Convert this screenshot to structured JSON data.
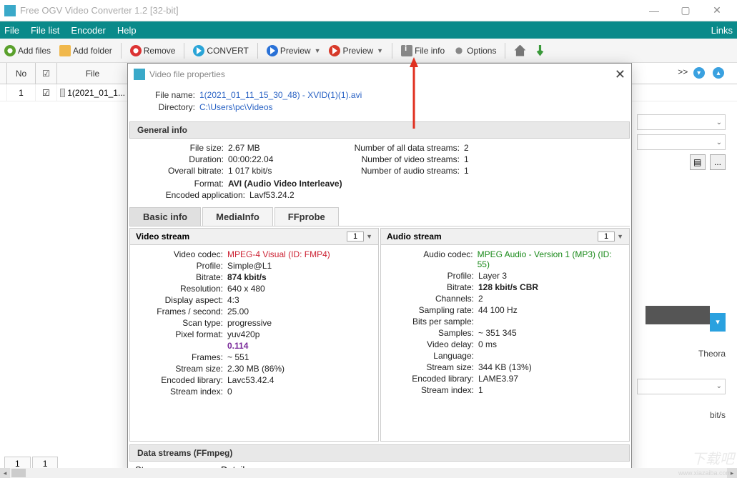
{
  "app": {
    "title": "Free OGV Video Converter 1.2  [32-bit]"
  },
  "menu": {
    "file": "File",
    "filelist": "File list",
    "encoder": "Encoder",
    "help": "Help",
    "links": "Links"
  },
  "tool": {
    "addfiles": "Add files",
    "addfolder": "Add folder",
    "remove": "Remove",
    "convert": "CONVERT",
    "preview1": "Preview",
    "preview2": "Preview",
    "fileinfo": "File info",
    "options": "Options"
  },
  "list": {
    "hdr_no": "No",
    "hdr_file": "File",
    "row1_no": "1",
    "row1_file": "1(2021_01_1..."
  },
  "pager": {
    "p1": "1",
    "p2": "1"
  },
  "right": {
    "theora": "Theora",
    "bits": "bit/s",
    "ellipsis": "...",
    "chevrons": ">>"
  },
  "dialog": {
    "title": "Video file properties",
    "filename_k": "File name:",
    "filename_v": "1(2021_01_11_15_30_48) - XVID(1)(1).avi",
    "directory_k": "Directory:",
    "directory_v": "C:\\Users\\pc\\Videos",
    "general_hdr": "General info",
    "g_filesize_k": "File size:",
    "g_filesize_v": "2.67 MB",
    "g_duration_k": "Duration:",
    "g_duration_v": "00:00:22.04",
    "g_bitrate_k": "Overall bitrate:",
    "g_bitrate_v": "1 017 kbit/s",
    "g_format_k": "Format:",
    "g_format_v": "AVI (Audio Video Interleave)",
    "g_encapp_k": "Encoded application:",
    "g_encapp_v": "Lavf53.24.2",
    "g_allstreams_k": "Number of all data streams:",
    "g_allstreams_v": "2",
    "g_vidstreams_k": "Number of video streams:",
    "g_vidstreams_v": "1",
    "g_audstreams_k": "Number of audio streams:",
    "g_audstreams_v": "1",
    "tabs": {
      "basic": "Basic info",
      "media": "MediaInfo",
      "ffprobe": "FFprobe"
    },
    "video": {
      "hdr": "Video stream",
      "num": "1",
      "codec_k": "Video codec:",
      "codec_v": "MPEG-4 Visual (ID: FMP4)",
      "profile_k": "Profile:",
      "profile_v": "Simple@L1",
      "bitrate_k": "Bitrate:",
      "bitrate_v": "874 kbit/s",
      "res_k": "Resolution:",
      "res_v": "640 x 480",
      "aspect_k": "Display aspect:",
      "aspect_v": "4:3",
      "fps_k": "Frames / second:",
      "fps_v": "25.00",
      "scan_k": "Scan type:",
      "scan_v": "progressive",
      "pix_k": "Pixel format:",
      "pix_v": "yuv420p",
      "val_k": "",
      "val_v": "0.114",
      "frames_k": "Frames:",
      "frames_v": "~ 551",
      "ssize_k": "Stream size:",
      "ssize_v": "2.30 MB (86%)",
      "enclib_k": "Encoded library:",
      "enclib_v": "Lavc53.42.4",
      "sidx_k": "Stream index:",
      "sidx_v": "0"
    },
    "audio": {
      "hdr": "Audio stream",
      "num": "1",
      "codec_k": "Audio codec:",
      "codec_v": "MPEG Audio - Version 1 (MP3) (ID: 55)",
      "profile_k": "Profile:",
      "profile_v": "Layer 3",
      "bitrate_k": "Bitrate:",
      "bitrate_v": "128 kbit/s  CBR",
      "ch_k": "Channels:",
      "ch_v": "2",
      "sr_k": "Sampling rate:",
      "sr_v": "44 100 Hz",
      "bps_k": "Bits per sample:",
      "bps_v": "",
      "samples_k": "Samples:",
      "samples_v": "~ 351 345",
      "vdelay_k": "Video delay:",
      "vdelay_v": "0 ms",
      "lang_k": "Language:",
      "lang_v": "",
      "ssize_k": "Stream size:",
      "ssize_v": "344 KB (13%)",
      "enclib_k": "Encoded library:",
      "enclib_v": "LAME3.97",
      "sidx_k": "Stream index:",
      "sidx_v": "1"
    },
    "datastreams_hdr": "Data streams   (FFmpeg)",
    "ds_col1": "Stream",
    "ds_col2": "Details"
  }
}
